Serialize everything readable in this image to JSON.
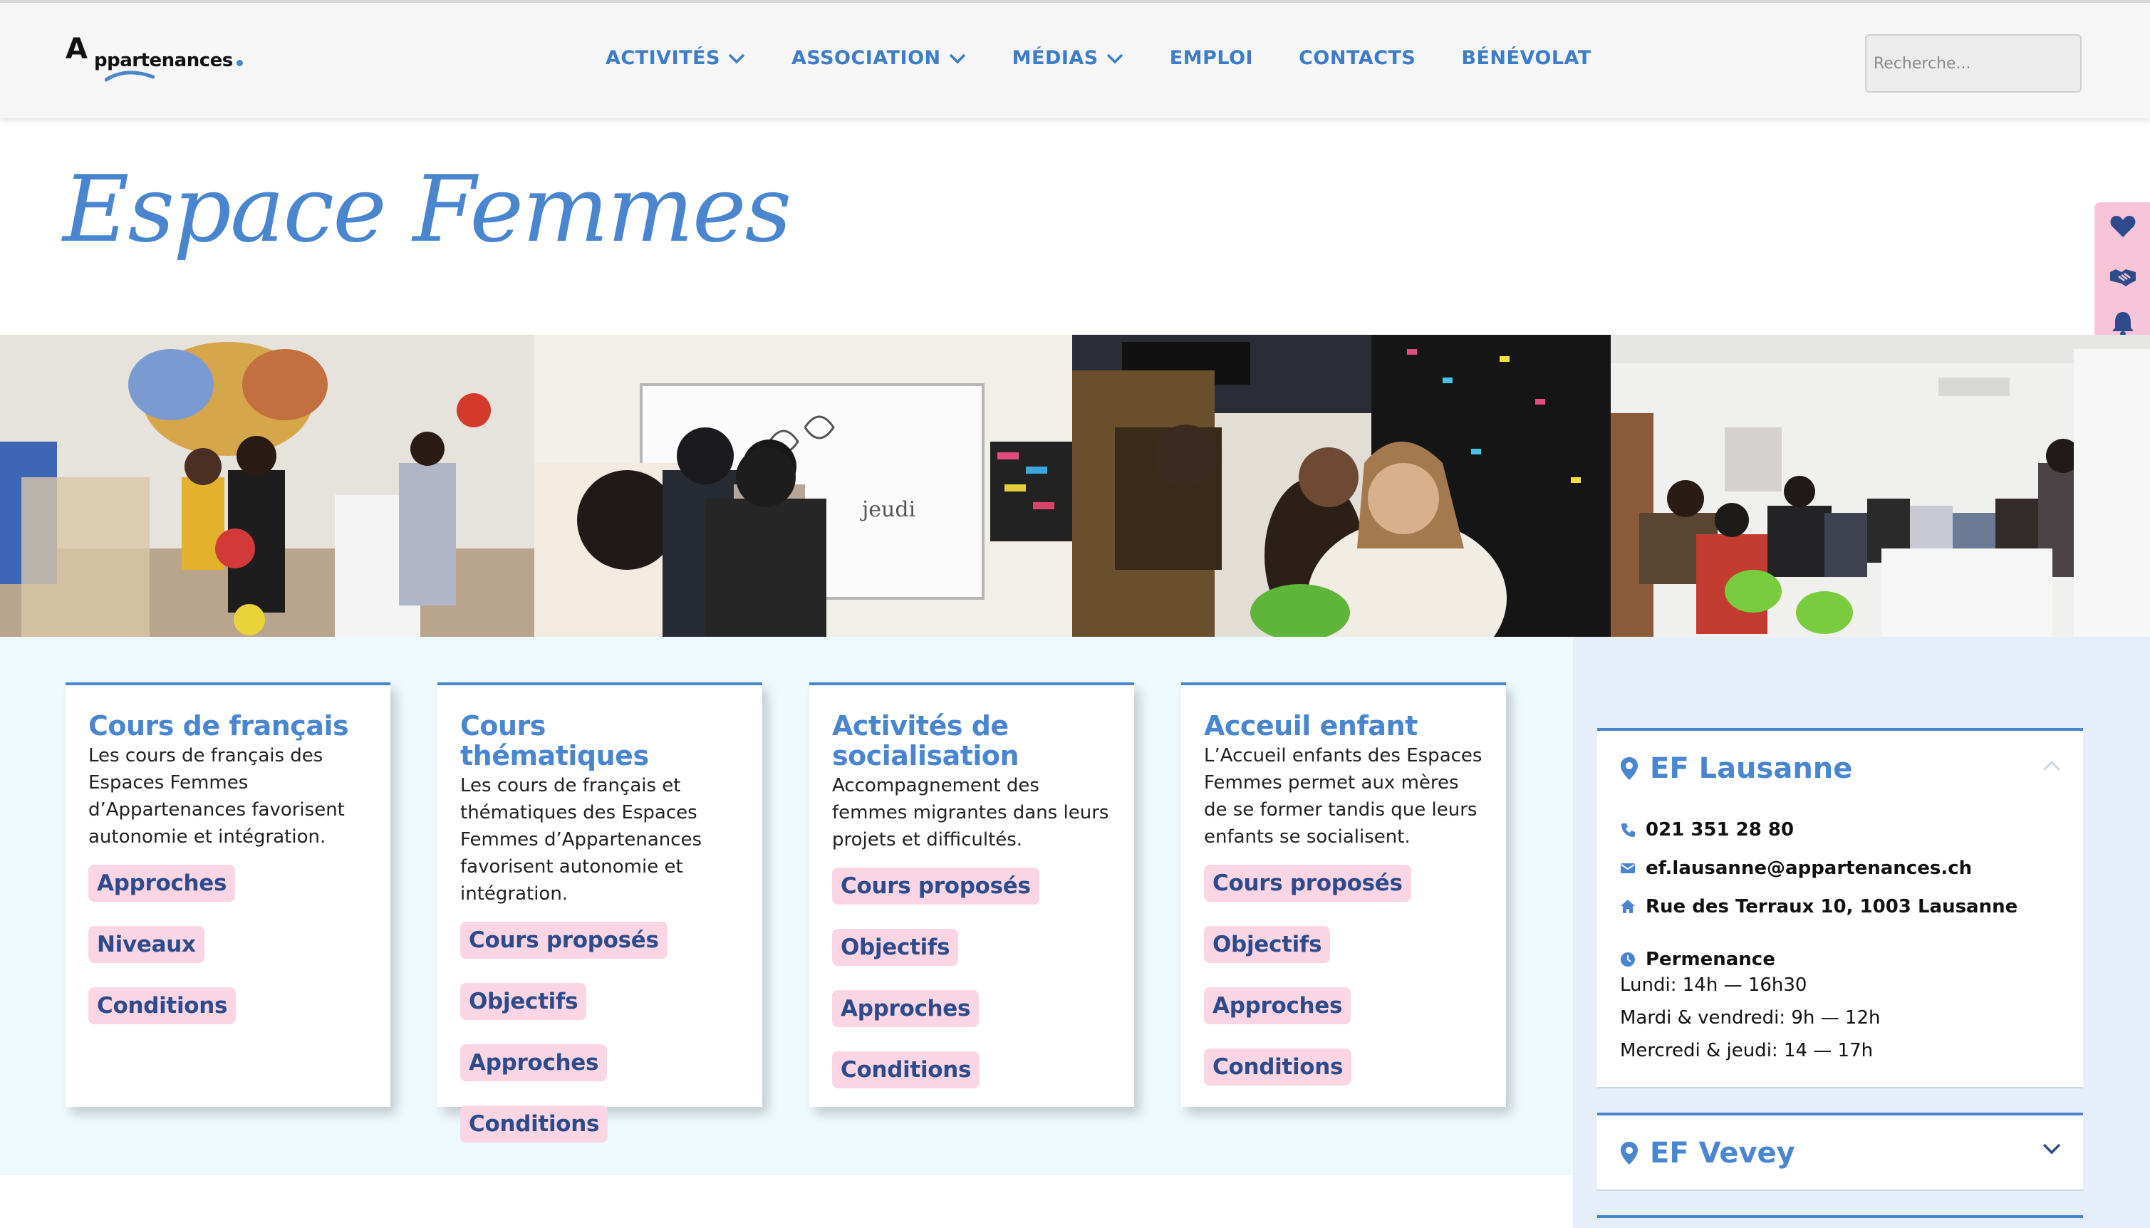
{
  "header": {
    "logo_big_letter": "A",
    "logo_text": "ppartenances",
    "nav": [
      {
        "label": "ACTIVITÉS",
        "dropdown": true
      },
      {
        "label": "ASSOCIATION",
        "dropdown": true
      },
      {
        "label": "MÉDIAS",
        "dropdown": true
      },
      {
        "label": "EMPLOI",
        "dropdown": false
      },
      {
        "label": "CONTACTS",
        "dropdown": false
      },
      {
        "label": "BÉNÉVOLAT",
        "dropdown": false
      }
    ],
    "search_placeholder": "Recherche..."
  },
  "page": {
    "title": "Espace Femmes"
  },
  "side_actions": [
    "heart-icon",
    "handshake-icon",
    "bell-icon"
  ],
  "cards": [
    {
      "title": "Cours de français",
      "text": "Les cours de français des Espaces Femmes d’Appartenances favorisent autonomie et intégration.",
      "tags": [
        "Approches",
        "Niveaux",
        "Conditions"
      ]
    },
    {
      "title": "Cours thématiques",
      "text": "Les cours de français et thématiques des Espaces Femmes d’Appartenances favorisent autonomie et intégration.",
      "tags": [
        "Cours proposés",
        "Objectifs",
        "Approches",
        "Conditions"
      ]
    },
    {
      "title": "Activités de socialisation",
      "text": "Accompagnement des femmes migrantes dans leurs projets et difficultés.",
      "tags": [
        "Cours proposés",
        "Objectifs",
        "Approches",
        "Conditions"
      ]
    },
    {
      "title": "Acceuil enfant",
      "text": "L’Accueil enfants des Espaces Femmes permet aux mères de se former tandis que leurs enfants se socialisent.",
      "tags": [
        "Cours proposés",
        "Objectifs",
        "Approches",
        "Conditions"
      ]
    }
  ],
  "locations": [
    {
      "name": "EF Lausanne",
      "expanded": true,
      "phone": "021 351 28 80",
      "email": "ef.lausanne@appartenances.ch",
      "address": "Rue des Terraux 10, 1003 Lausanne",
      "hours_label": "Permenance",
      "hours": [
        "Lundi: 14h — 16h30",
        "Mardi & vendredi: 9h — 12h",
        "Mercredi & jeudi: 14 — 17h"
      ]
    },
    {
      "name": "EF Vevey",
      "expanded": false
    }
  ],
  "colors": {
    "accent": "#4a86d0",
    "tag_bg": "#fad6e4",
    "tag_text": "#2d4b8a",
    "side_bar": "#f7c4d8"
  }
}
